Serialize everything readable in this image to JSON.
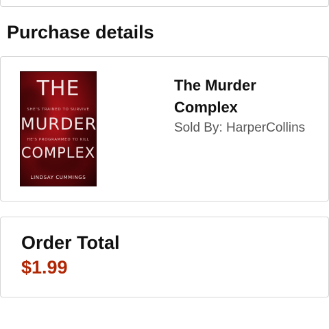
{
  "purchase": {
    "section_title": "Purchase details",
    "item": {
      "title": "The Murder Complex",
      "sold_by_label": "Sold By: HarperCollins",
      "cover": {
        "title_line1": "THE",
        "title_line2": "MURDER",
        "title_line3": "COMPLEX",
        "tagline1": "SHE'S TRAINED TO SURVIVE",
        "tagline2": "HE'S PROGRAMMED TO KILL",
        "author": "LINDSAY CUMMINGS"
      }
    }
  },
  "order": {
    "total_label": "Order Total",
    "total_value": "$1.99",
    "total_color": "#b12704"
  }
}
